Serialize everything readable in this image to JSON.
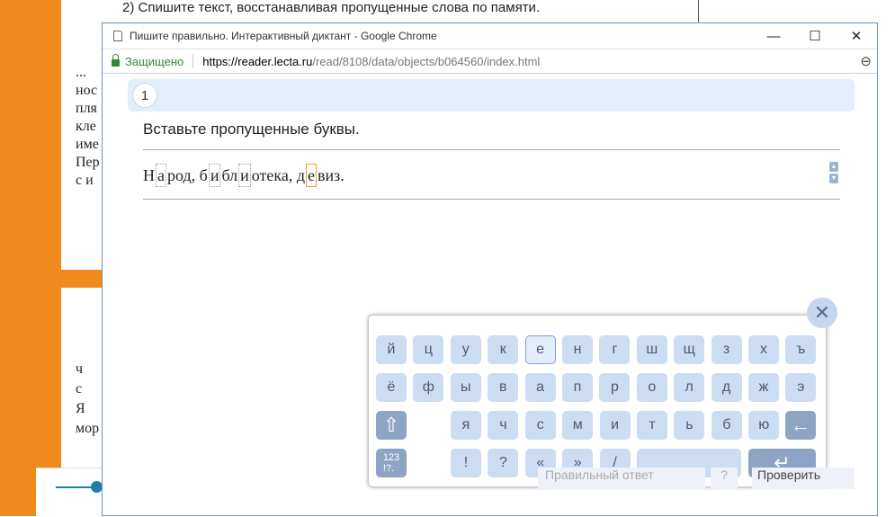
{
  "bg": {
    "instruction": "2) Спишите текст, восстанавливая пропущенные слова по памяти.",
    "lines_top": [
      "...",
      "нос",
      "пля",
      "кле",
      "име",
      "Пер",
      "с и"
    ],
    "lines_bottom": [
      "ч",
      "с",
      "Я",
      "мор"
    ]
  },
  "window": {
    "title": "Пишите правильно. Интерактивный диктант - Google Chrome",
    "minimize": "—",
    "maximize": "☐",
    "close": "✕"
  },
  "address": {
    "secure_label": "Защищено",
    "url_host": "https://reader.lecta.ru",
    "url_path": "/read/8108/data/objects/b064560/index.html",
    "zoom_icon": "⊖"
  },
  "exercise": {
    "number": "1",
    "prompt": "Вставьте пропущенные буквы.",
    "parts": [
      "Н",
      "а",
      "род, б",
      "и",
      "бл",
      "и",
      "отека, д",
      "е",
      "виз."
    ],
    "gaps": [
      1,
      3,
      5,
      7
    ],
    "active_gap": 7
  },
  "keyboard": {
    "row1": [
      "й",
      "ц",
      "у",
      "к",
      "е",
      "н",
      "г",
      "ш",
      "щ",
      "з",
      "х",
      "ъ"
    ],
    "row2": [
      "ё",
      "ф",
      "ы",
      "в",
      "а",
      "п",
      "р",
      "о",
      "л",
      "д",
      "ж",
      "э"
    ],
    "row3": [
      "я",
      "ч",
      "с",
      "м",
      "и",
      "т",
      "ь",
      "б",
      "ю"
    ],
    "row4": [
      "!",
      "?",
      "«",
      "»",
      "/"
    ],
    "numbers_label": "123\n!?.",
    "active_key": "е"
  },
  "footer": {
    "show_answer": "Правильный ответ",
    "help": "?",
    "check": "Проверить"
  }
}
